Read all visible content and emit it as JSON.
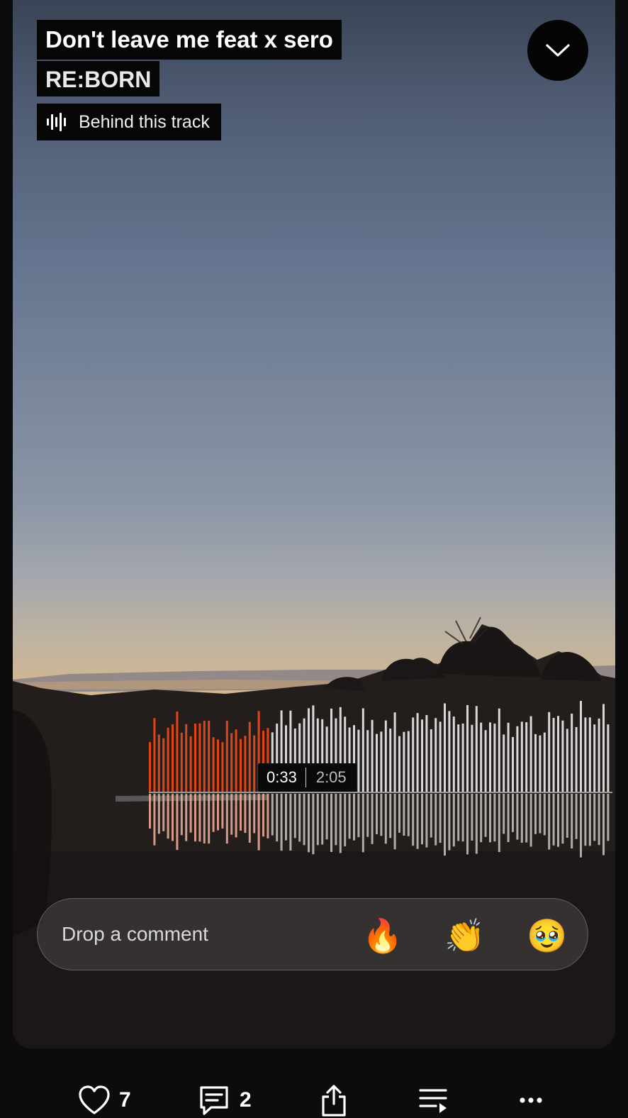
{
  "track": {
    "title": "Don't leave me feat x sero",
    "artist": "RE:BORN",
    "behind_label": "Behind this track"
  },
  "player": {
    "current_time": "0:33",
    "total_time": "2:05",
    "progress": 0.264
  },
  "comment": {
    "placeholder": "Drop a comment",
    "reactions": [
      "🔥",
      "👏",
      "🥹"
    ]
  },
  "actions": {
    "likes": "7",
    "comments": "2"
  },
  "colors": {
    "played": "#e8491b",
    "unplayed": "#f2f2f2",
    "label_bg": "#060606"
  },
  "icons": [
    "chevron-down-icon",
    "waveform-icon",
    "heart-icon",
    "comment-icon",
    "share-icon",
    "queue-icon",
    "more-icon"
  ]
}
